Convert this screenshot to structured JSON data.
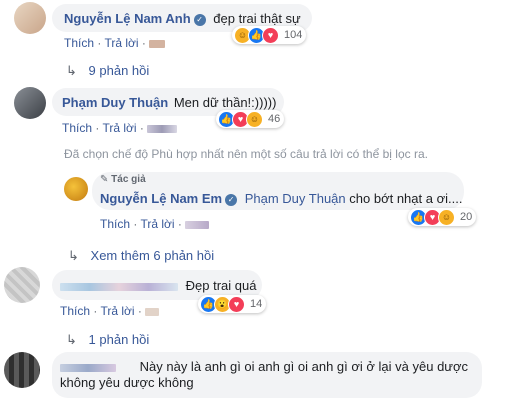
{
  "comments": [
    {
      "author": "Nguyễn Lệ Nam Anh",
      "text": "đẹp trai thật sự",
      "like_label": "Thích",
      "reply_label": "Trả lời",
      "reaction_count": "104",
      "reactions": [
        "haha",
        "like",
        "love"
      ]
    },
    {
      "author": "Phạm Duy Thuận",
      "text": "Men dữ thần!:)))))",
      "like_label": "Thích",
      "reply_label": "Trả lời",
      "reaction_count": "46",
      "reactions": [
        "like",
        "love",
        "haha"
      ]
    },
    {
      "author": "",
      "text": "Đẹp trai quá",
      "like_label": "Thích",
      "reply_label": "Trả lời",
      "reaction_count": "14",
      "reactions": [
        "like",
        "wow",
        "love"
      ]
    },
    {
      "author": "",
      "text_line1": "Này này là anh gì oi anh gì oi anh gì ơi ở lại và yêu dược",
      "text_line2": "không yêu dược không"
    }
  ],
  "replies_toggle_1": "9 phản hồi",
  "filter_notice": "Đã chọn chế độ Phù hợp nhất nên một số câu trả lời có thể bị lọc ra.",
  "reply": {
    "author_badge": "Tác giả",
    "author": "Nguyễn Lệ Nam Em",
    "mention": "Phạm Duy Thuận",
    "text": "cho bớt nhạt a ơi....",
    "like_label": "Thích",
    "reply_label": "Trả lời",
    "reaction_count": "20",
    "reactions": [
      "like",
      "love",
      "haha"
    ]
  },
  "more_replies": "Xem thêm 6 phản hồi",
  "replies_toggle_2": "1 phản hồi",
  "icons": {
    "reply_arrow": "reply-arrow-icon",
    "verified": "verified-icon",
    "pen": "author-pen-icon"
  }
}
